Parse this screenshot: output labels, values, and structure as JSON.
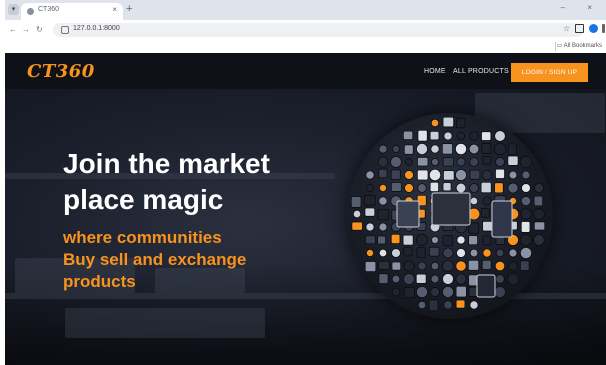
{
  "browser": {
    "tab_title": "CT360",
    "tab_close": "×",
    "new_tab": "+",
    "window_controls": "–  ×",
    "back": "←",
    "forward": "→",
    "reload": "↻",
    "address": "127.0.0.1:8000",
    "zoom_icon": "search-icon",
    "star_icon": "☆",
    "bookmark_folder": "All Bookmarks"
  },
  "site": {
    "logo": "CT360",
    "nav": {
      "home": "HOME",
      "all_products": "ALL PRODUCTS",
      "login": "LOGIN / SIGN UP"
    },
    "hero": {
      "title_line1": "Join the market",
      "title_line2": "place magic",
      "sub_line1": "where communities",
      "sub_line2": "Buy sell and exchange",
      "sub_line3": "products"
    },
    "colors": {
      "accent": "#f7931e",
      "nav_bg": "#0e1118",
      "hero_text": "#ffffff"
    }
  }
}
